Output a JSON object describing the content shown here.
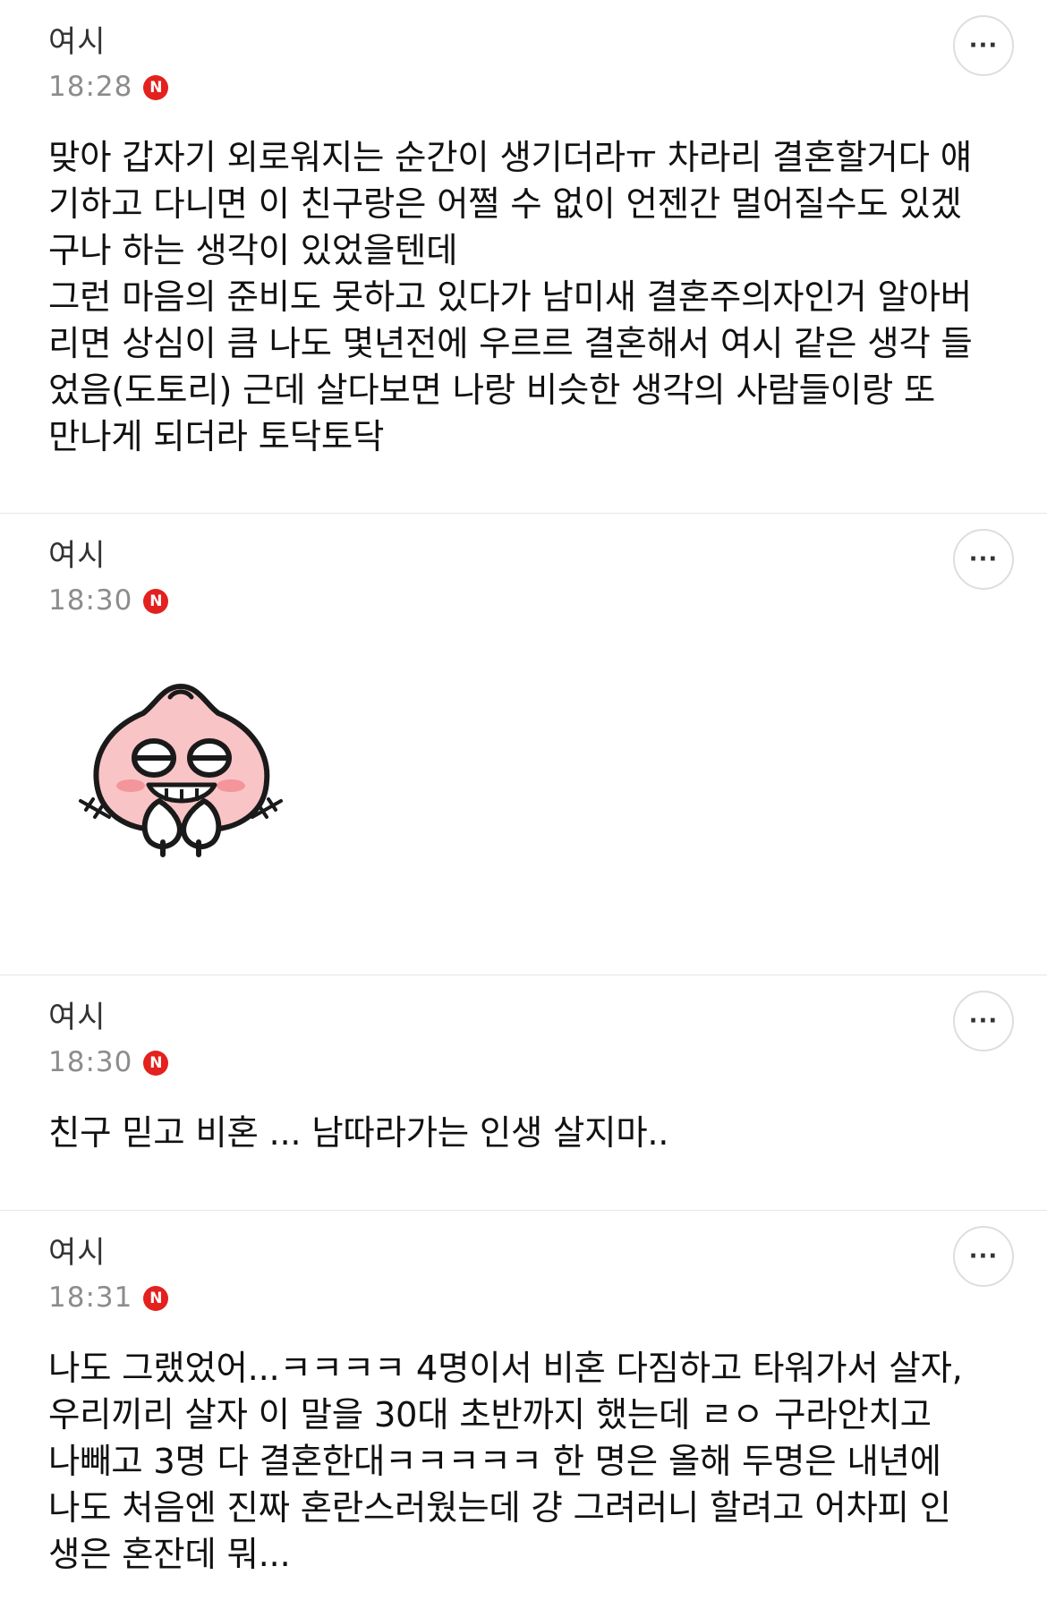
{
  "comments": [
    {
      "author": "여시",
      "time": "18:28",
      "badge": "N",
      "text": "맞아 갑자기 외로워지는 순간이 생기더라ㅠ 차라리 결혼할거다 얘\n기하고 다니면 이 친구랑은 어쩔 수 없이 언젠간 멀어질수도 있겠\n구나 하는 생각이 있었을텐데\n그런 마음의 준비도 못하고 있다가 남미새 결혼주의자인거 알아버\n리면 상심이 큼 나도 몇년전에 우르르 결혼해서 여시 같은 생각 들\n었음(도토리) 근데 살다보면 나랑 비슷한 생각의 사람들이랑 또\n만나게 되더라 토닥토닥"
    },
    {
      "author": "여시",
      "time": "18:30",
      "badge": "N",
      "sticker": "peach-character-sticker"
    },
    {
      "author": "여시",
      "time": "18:30",
      "badge": "N",
      "text": "친구 믿고 비혼 ... 남따라가는 인생 살지마.."
    },
    {
      "author": "여시",
      "time": "18:31",
      "badge": "N",
      "text": "나도 그랬었어...ㅋㅋㅋㅋ 4명이서 비혼 다짐하고 타워가서 살자,\n우리끼리 살자 이 말을 30대 초반까지 했는데 ㄹㅇ 구라안치고\n나빼고 3명 다 결혼한대ㅋㅋㅋㅋㅋ 한 명은 올해 두명은 내년에\n나도 처음엔 진짜 혼란스러웠는데 걍 그려러니 할려고 어차피 인\n생은 혼잔데 뭐..."
    }
  ],
  "more_button_label": "···",
  "colors": {
    "badge": "#e3211e",
    "time": "#8c8c8c",
    "divider": "#e6e6e6",
    "sticker_body": "#f9c4c5",
    "sticker_cheek": "#f3959b"
  }
}
